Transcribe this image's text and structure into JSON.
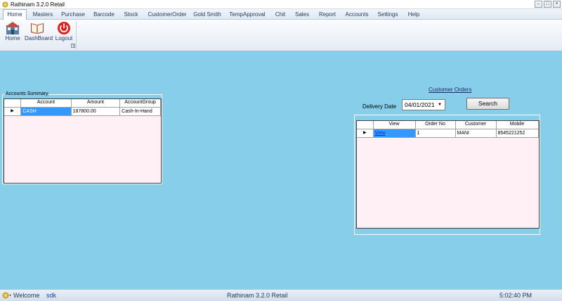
{
  "window": {
    "title": "Rathinam 3.2.0 Retail"
  },
  "menu": [
    "Home",
    "Masters",
    "Purchase",
    "Barcode",
    "Stock",
    "CustomerOrder",
    "Gold Smith",
    "TempApproval",
    "Chit",
    "Sales",
    "Report",
    "Accounts",
    "Settings",
    "Help"
  ],
  "ribbon": {
    "home_label": "Home",
    "dashboard_label": "DashBoard",
    "logout_label": "Logout"
  },
  "accounts_summary": {
    "title": "Accounts Summary",
    "columns": [
      "Account",
      "Amount",
      "AccountGroup"
    ],
    "rows": [
      {
        "account": "CASH",
        "amount": "187800.00",
        "group": "Cash-In-Hand"
      }
    ]
  },
  "customer_orders": {
    "title": "Customer Orders",
    "delivery_label": "Delivery Date",
    "delivery_date": "04/01/2021",
    "search_label": "Search",
    "columns": [
      "View",
      "Order No",
      "Customer",
      "Mobile"
    ],
    "rows": [
      {
        "view": "View",
        "order_no": "1",
        "customer": "MANI",
        "mobile": "8545221252"
      }
    ]
  },
  "status": {
    "welcome": "Welcome",
    "user": "sdk",
    "center": "Rathinam 3.2.0 Retail",
    "time": "5:02:40 PM"
  },
  "colors": {
    "background": "#87ceeb",
    "grid_bg": "#fff0f5",
    "selection": "#3399ff"
  }
}
